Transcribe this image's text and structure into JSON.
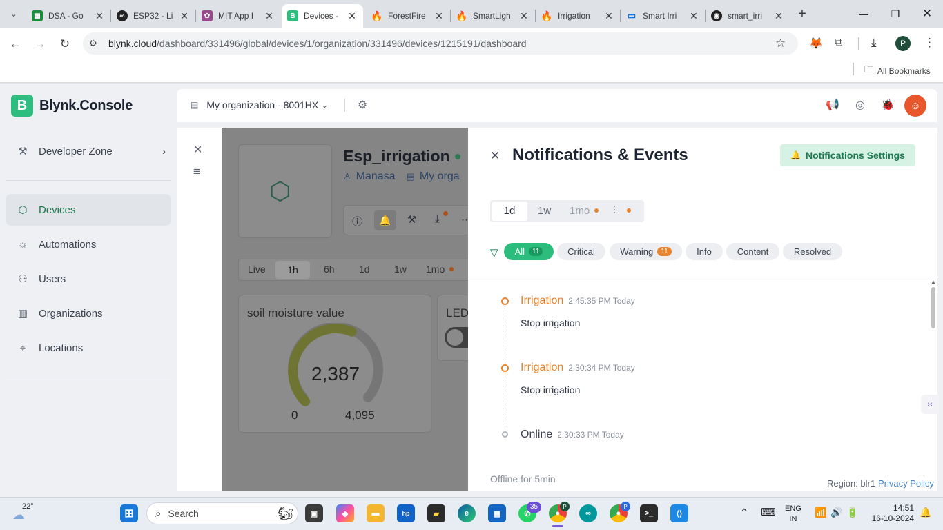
{
  "browser": {
    "tabs": [
      {
        "title": "DSA - Go",
        "color": "#1e8e3e",
        "icon": "sheets-icon"
      },
      {
        "title": "ESP32 - Li",
        "color": "#222222",
        "icon": "arduino-icon"
      },
      {
        "title": "MIT App I",
        "color": "#9a4a8c",
        "icon": "app-inventor-icon"
      },
      {
        "title": "Devices -",
        "color": "#2dbd7e",
        "icon": "blynk-icon"
      },
      {
        "title": "ForestFire",
        "color": "#f57c00",
        "icon": "firebase-icon"
      },
      {
        "title": "SmartLigh",
        "color": "#f57c00",
        "icon": "firebase-icon"
      },
      {
        "title": "Irrigation",
        "color": "#f57c00",
        "icon": "firebase-icon"
      },
      {
        "title": "Smart Irri",
        "color": "#1a73e8",
        "icon": "monitor-icon"
      },
      {
        "title": "smart_irri",
        "color": "#222222",
        "icon": "github-icon"
      }
    ],
    "url_host": "blynk.cloud",
    "url_path": "/dashboard/331496/global/devices/1/organization/331496/devices/1215191/dashboard",
    "profile_initial": "P",
    "all_bookmarks": "All Bookmarks"
  },
  "app": {
    "brand_letter": "B",
    "brand_name": "Blynk.Console",
    "sidebar": [
      {
        "label": "Developer Zone",
        "icon": "tools-icon"
      },
      {
        "label": "Devices",
        "icon": "cube-icon"
      },
      {
        "label": "Automations",
        "icon": "sun-icon"
      },
      {
        "label": "Users",
        "icon": "users-icon"
      },
      {
        "label": "Organizations",
        "icon": "building-icon"
      },
      {
        "label": "Locations",
        "icon": "pin-icon"
      }
    ],
    "org_name": "My organization - 8001HX",
    "device": {
      "name": "Esp_irrigation",
      "owner": "Manasa",
      "org_short": "My orga",
      "time_tabs": [
        "Live",
        "1h",
        "6h",
        "1d",
        "1w",
        "1mo"
      ],
      "gauge_title": "soil moisture value",
      "gauge_value": "2,387",
      "gauge_min": "0",
      "gauge_max": "4,095",
      "gauge_fraction": 0.583,
      "led_label": "LED"
    },
    "panel": {
      "title": "Notifications & Events",
      "settings_button": "Notifications Settings",
      "ranges": [
        "1d",
        "1w",
        "1mo"
      ],
      "filters": [
        {
          "label": "All",
          "count": "11"
        },
        {
          "label": "Critical",
          "count": ""
        },
        {
          "label": "Warning",
          "count": "11"
        },
        {
          "label": "Info",
          "count": ""
        },
        {
          "label": "Content",
          "count": ""
        },
        {
          "label": "Resolved",
          "count": ""
        }
      ],
      "events": [
        {
          "name": "Irrigation",
          "time": "2:45:35 PM Today",
          "desc": "Stop irrigation"
        },
        {
          "name": "Irrigation",
          "time": "2:30:34 PM Today",
          "desc": "Stop irrigation"
        },
        {
          "name": "Online",
          "time": "2:30:33 PM Today",
          "desc": ""
        }
      ],
      "offline_note": "Offline for 5min"
    },
    "footer": {
      "region": "Region: blr1",
      "privacy": "Privacy Policy"
    }
  },
  "taskbar": {
    "temperature": "22°",
    "search": "Search",
    "lang1": "ENG",
    "lang2": "IN",
    "time": "14:51",
    "date": "16-10-2024",
    "whatsapp_badge": "35"
  }
}
